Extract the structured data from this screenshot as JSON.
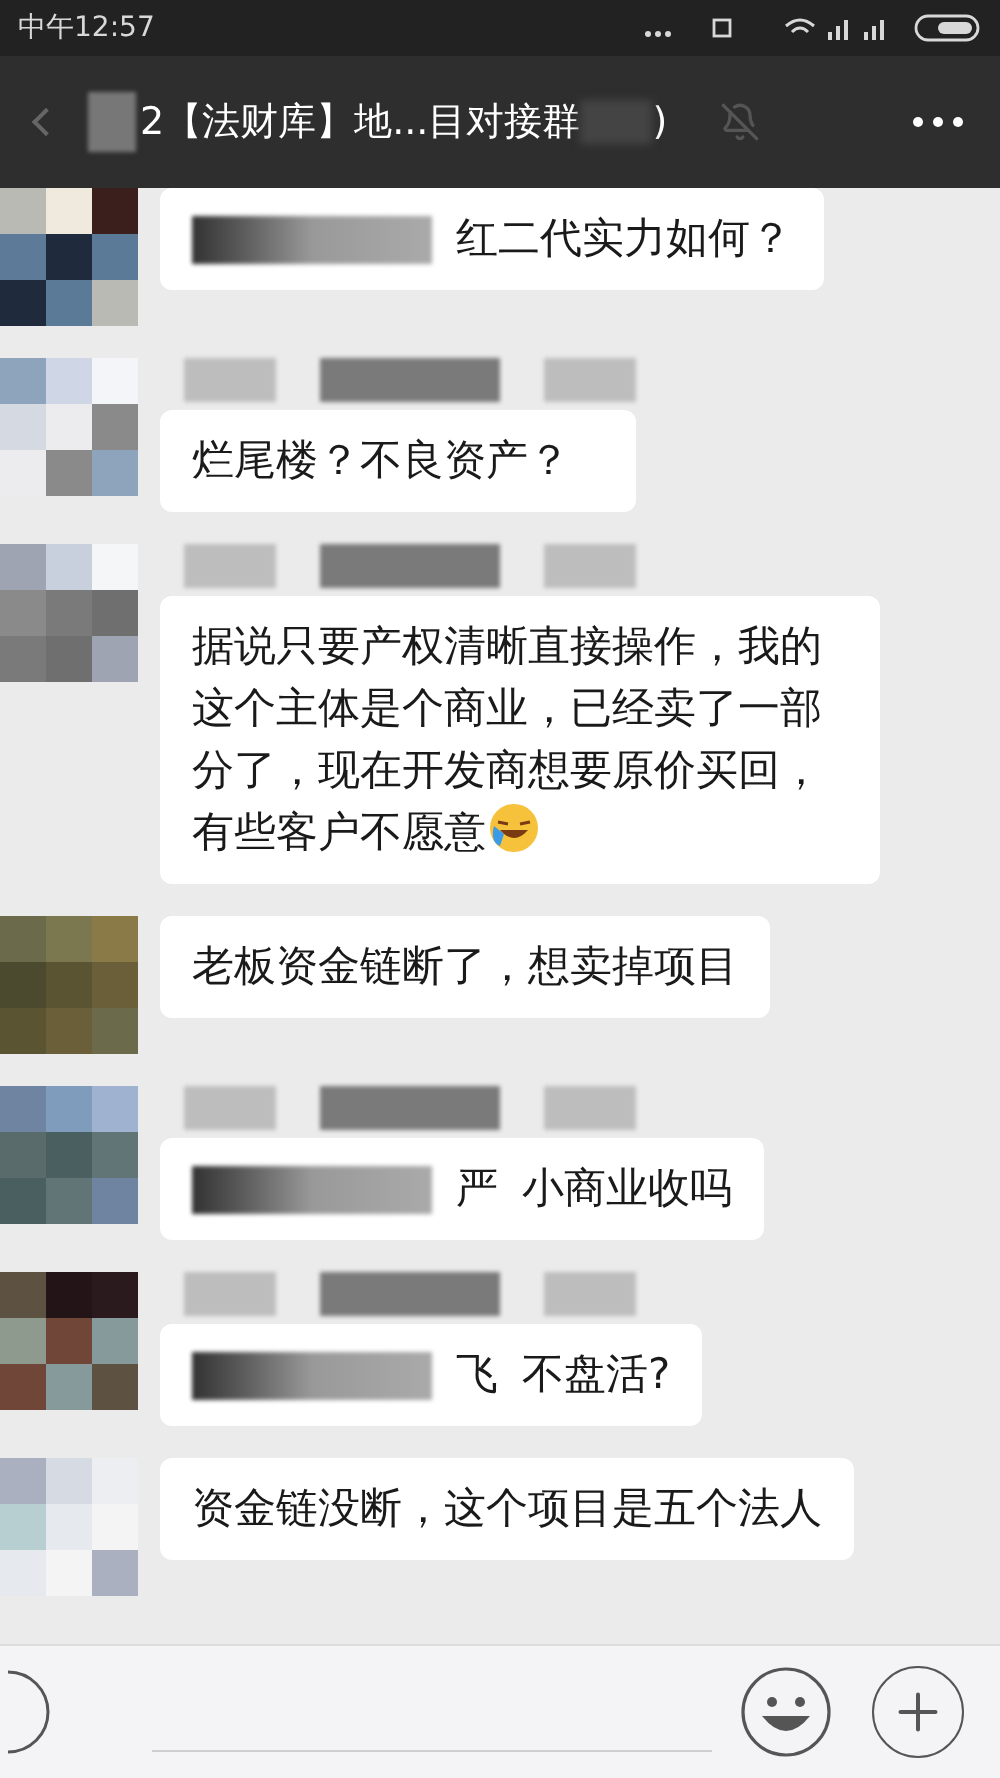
{
  "status_bar": {
    "time": "中午12:57"
  },
  "header": {
    "title": "2【法财库】地...目对接群",
    "title_suffix": ")"
  },
  "messages": [
    {
      "kind": "text",
      "name_hidden": false,
      "redacted": true,
      "parts": [
        "红二代实力如何？"
      ]
    },
    {
      "kind": "text",
      "name_hidden": true,
      "redacted": false,
      "parts": [
        "烂尾楼？不良资产？"
      ]
    },
    {
      "kind": "emoji",
      "name_hidden": true,
      "redacted": false,
      "parts": [
        "据说只要产权清晰直接操作，我的这个主体是个商业，已经卖了一部分了，现在开发商想要原价买回，有些客户不愿意"
      ]
    },
    {
      "kind": "text",
      "name_hidden": false,
      "redacted": false,
      "parts": [
        "老板资金链断了，想卖掉项目"
      ]
    },
    {
      "kind": "text",
      "name_hidden": true,
      "redacted": true,
      "parts": [
        "严",
        "小商业收吗"
      ]
    },
    {
      "kind": "text",
      "name_hidden": true,
      "redacted": true,
      "parts": [
        "飞",
        "不盘活?"
      ]
    },
    {
      "kind": "text",
      "name_hidden": false,
      "redacted": false,
      "parts": [
        "资金链没断，这个项目是五个法人"
      ]
    }
  ]
}
